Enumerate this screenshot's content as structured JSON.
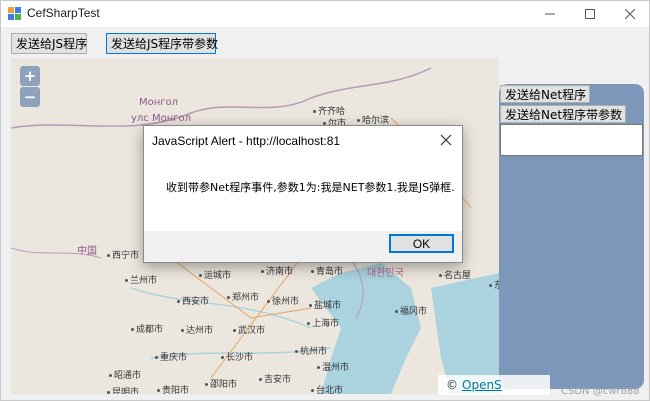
{
  "window": {
    "title": "CefSharpTest",
    "minimize": "—",
    "maximize": "☐",
    "close": "✕"
  },
  "toolbar": {
    "send_js_label": "发送给JS程序",
    "send_js_params_label": "发送给JS程序带参数"
  },
  "map": {
    "zoom_in": "+",
    "zoom_out": "−",
    "regions": [
      {
        "text": "Монгол",
        "color": "#8a5a8a"
      },
      {
        "text": "улс Монгол",
        "color": "#8a5a8a"
      },
      {
        "text": "中国",
        "color": "#8a5a8a"
      },
      {
        "text": "대한민국",
        "color": "#8a5a8a"
      }
    ],
    "cities": [
      "齐齐哈",
      "哈尔滨",
      "尔市",
      "西宁市",
      "兰州市",
      "运城市",
      "济南市",
      "青岛市",
      "名古屋",
      "东",
      "西安市",
      "郑州市",
      "徐州市",
      "盐城市",
      "福冈市",
      "成都市",
      "达州市",
      "武汉市",
      "上海市",
      "重庆市",
      "长沙市",
      "杭州市",
      "温州市",
      "昭通市",
      "贵阳市",
      "邵阳市",
      "吉安市",
      "台北市",
      "昆明市"
    ],
    "attribution_prefix": "©",
    "attribution_link": "OpenS"
  },
  "side_panel": {
    "send_net_label": "发送给Net程序",
    "send_net_params_label": "发送给Net程序带参数",
    "textbox_value": ""
  },
  "dialog": {
    "title": "JavaScript Alert - http://localhost:81",
    "message": "收到带参Net程序事件,参数1为:我是NET参数1.我是JS弹框.",
    "ok_label": "OK"
  },
  "watermark": "CSDN @cwr888",
  "colors": {
    "map_land": "#ece7de",
    "map_sea": "#aad3df",
    "panel": "#7d97ba",
    "accent": "#0078d7"
  }
}
